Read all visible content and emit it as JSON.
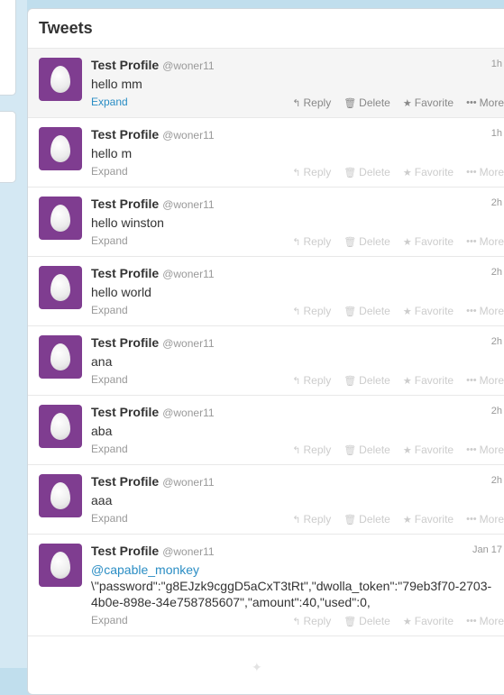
{
  "panel": {
    "title": "Tweets"
  },
  "labels": {
    "expand": "Expand",
    "reply": "Reply",
    "delete": "Delete",
    "favorite": "Favorite",
    "more": "More"
  },
  "icons": {
    "reply": "reply-icon",
    "delete": "trash-icon",
    "favorite": "star-icon",
    "more": "more-dots-icon",
    "avatar": "egg-avatar-icon"
  },
  "colors": {
    "avatar_bg": "#7f3d90",
    "link": "#2a8dc4",
    "background": "#c0deed"
  },
  "tweets": [
    {
      "name": "Test Profile",
      "handle": "@woner11",
      "time": "1h",
      "text": "hello mm"
    },
    {
      "name": "Test Profile",
      "handle": "@woner11",
      "time": "1h",
      "text": "hello m"
    },
    {
      "name": "Test Profile",
      "handle": "@woner11",
      "time": "2h",
      "text": "hello winston"
    },
    {
      "name": "Test Profile",
      "handle": "@woner11",
      "time": "2h",
      "text": "hello world"
    },
    {
      "name": "Test Profile",
      "handle": "@woner11",
      "time": "2h",
      "text": "ana"
    },
    {
      "name": "Test Profile",
      "handle": "@woner11",
      "time": "2h",
      "text": "aba"
    },
    {
      "name": "Test Profile",
      "handle": "@woner11",
      "time": "2h",
      "text": "aaa"
    },
    {
      "name": "Test Profile",
      "handle": "@woner11",
      "time": "Jan 17",
      "mention": "@capable_monkey",
      "text": "\\\"password\":\"g8EJzk9cggD5aCxT3tRt\",\"dwolla_token\":\"79eb3f70-2703-4b0e-898e-34e758785607\",\"amount\":40,\"used\":0,"
    }
  ]
}
